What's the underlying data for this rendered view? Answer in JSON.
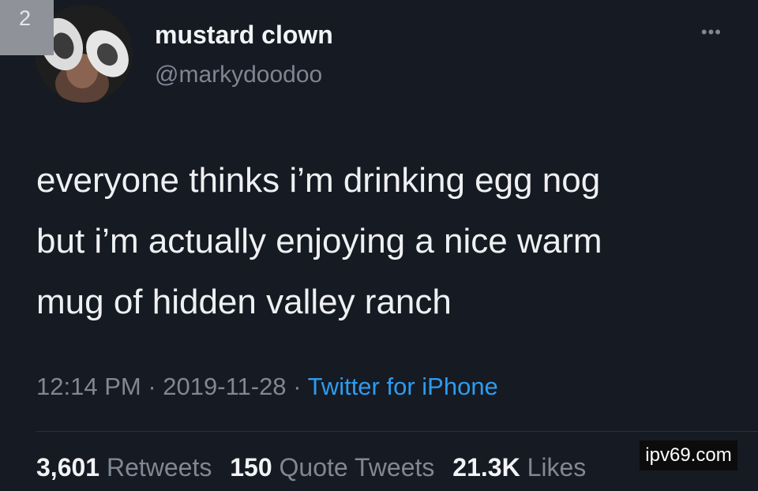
{
  "overlay": {
    "corner_number": "2",
    "watermark": "ipv69.com"
  },
  "tweet": {
    "display_name": "mustard clown",
    "handle": "@markydoodoo",
    "more_icon": "more-options-icon",
    "text_lines": [
      "everyone thinks i’m drinking egg nog",
      "but i’m actually enjoying a nice warm",
      "mug of hidden valley ranch"
    ],
    "time": "12:14 PM",
    "date": "2019-11-28",
    "separator": "·",
    "source": "Twitter for iPhone",
    "stats": {
      "retweets_count": "3,601",
      "retweets_label": "Retweets",
      "quotes_count": "150",
      "quotes_label": "Quote Tweets",
      "likes_count": "21.3K",
      "likes_label": "Likes"
    }
  },
  "colors": {
    "background": "#161a22",
    "link": "#2d9cf0",
    "muted": "#7f8893"
  }
}
